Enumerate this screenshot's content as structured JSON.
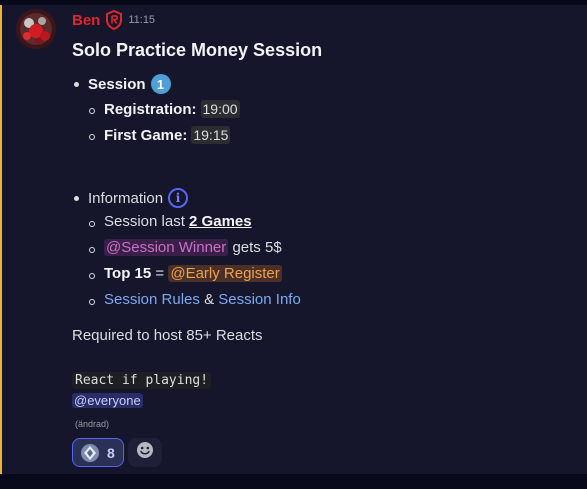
{
  "message": {
    "author": "Ben",
    "timestamp": "11:15",
    "title": "Solo Practice Money Session",
    "session": {
      "label": "Session",
      "number": "1",
      "registration_label": "Registration:",
      "registration_time": "19:00",
      "first_game_label": "First Game:",
      "first_game_time": "19:15"
    },
    "information": {
      "label": "Information",
      "icon_glyph": "i",
      "session_last_prefix": "Session last",
      "session_last_value": "2 Games",
      "winner_mention": "@Session Winner",
      "winner_suffix": "gets 5$",
      "top_label": "Top 15",
      "top_equals": "=",
      "early_mention": "@Early Register",
      "rules_link": "Session Rules",
      "and_text": "&",
      "info_link": "Session Info"
    },
    "required_text": "Required to host 85+ Reacts",
    "code_text": "React if playing!",
    "everyone_mention": "@everyone",
    "edited_text": "(ändrad)",
    "reaction": {
      "icon": "diamond-badge-icon",
      "count": "8"
    },
    "add_reaction_icon": "smiley-icon"
  },
  "colors": {
    "username": "#e0262a",
    "accent": "#5865f2",
    "highlight_bar": "#f0b232",
    "link": "#7ea8f2"
  }
}
